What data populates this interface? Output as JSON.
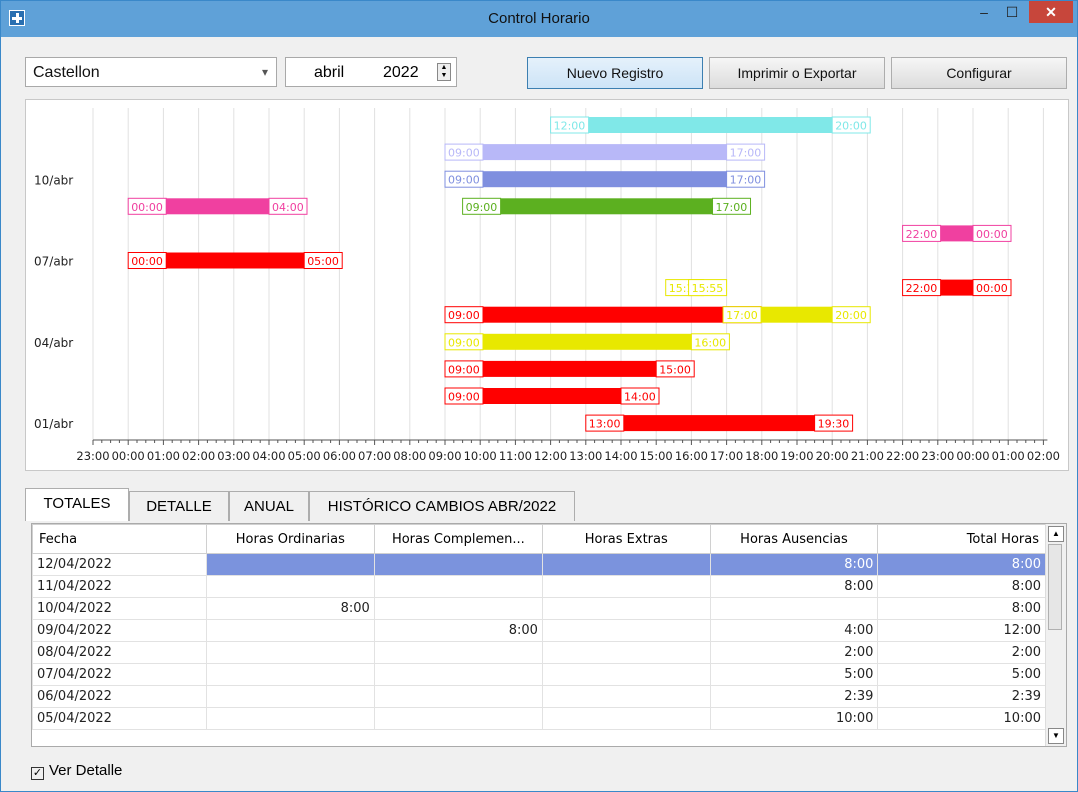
{
  "window": {
    "title": "Control Horario",
    "min_glyph": "–",
    "max_glyph": "☐",
    "close_glyph": "✕"
  },
  "toolbar": {
    "location": "Castellon",
    "month": "abril",
    "year": "2022",
    "new_label": "Nuevo Registro",
    "print_label": "Imprimir o Exportar",
    "config_label": "Configurar"
  },
  "chart_data": {
    "type": "gantt",
    "x_ticks": [
      "23:00",
      "00:00",
      "01:00",
      "02:00",
      "03:00",
      "04:00",
      "05:00",
      "06:00",
      "07:00",
      "08:00",
      "09:00",
      "10:00",
      "11:00",
      "12:00",
      "13:00",
      "14:00",
      "15:00",
      "16:00",
      "17:00",
      "18:00",
      "19:00",
      "20:00",
      "21:00",
      "22:00",
      "23:00",
      "00:00",
      "01:00",
      "02:00"
    ],
    "y_labels": [
      {
        "label": "10/abr",
        "row": 2.3
      },
      {
        "label": "07/abr",
        "row": 5.3
      },
      {
        "label": "04/abr",
        "row": 8.3
      },
      {
        "label": "01/abr",
        "row": 11.3
      }
    ],
    "bars": [
      {
        "row": 0,
        "start": "12:00",
        "end": "20:00",
        "s": 13,
        "e": 21,
        "color": "#80e8e8"
      },
      {
        "row": 1,
        "start": "09:00",
        "end": "17:00",
        "s": 10,
        "e": 18,
        "color": "#b8b8f8"
      },
      {
        "row": 2,
        "start": "09:00",
        "end": "17:00",
        "s": 10,
        "e": 18,
        "color": "#7f8fdf"
      },
      {
        "row": 3,
        "start": "00:00",
        "end": "04:00",
        "s": 1,
        "e": 5,
        "color": "#f040a0"
      },
      {
        "row": 3,
        "start": "09:00",
        "end": "17:00",
        "s": 10.5,
        "e": 17.6,
        "color": "#5cb020"
      },
      {
        "row": 4,
        "start": "22:00",
        "end": "00:00",
        "s": 23,
        "e": 25,
        "color": "#f040a0"
      },
      {
        "row": 5,
        "start": "00:00",
        "end": "05:00",
        "s": 1,
        "e": 6,
        "color": "#ff0000"
      },
      {
        "row": 6,
        "start": "15:16",
        "end": "15:55",
        "s": 16.27,
        "e": 16.92,
        "color": "#e8e800"
      },
      {
        "row": 6,
        "start": "22:00",
        "end": "00:00",
        "s": 23,
        "e": 25,
        "color": "#ff0000"
      },
      {
        "row": 7,
        "start": "09:00",
        "end": "17:00",
        "s": 10,
        "e": 17.9,
        "color": "#ff0000"
      },
      {
        "row": 7,
        "start": "17:00",
        "end": "20:00",
        "s": 17.9,
        "e": 21,
        "color": "#e8e800"
      },
      {
        "row": 8,
        "start": "09:00",
        "end": "16:00",
        "s": 10,
        "e": 17,
        "color": "#e8e800"
      },
      {
        "row": 9,
        "start": "09:00",
        "end": "15:00",
        "s": 10,
        "e": 16,
        "color": "#ff0000"
      },
      {
        "row": 10,
        "start": "09:00",
        "end": "14:00",
        "s": 10,
        "e": 15,
        "color": "#ff0000"
      },
      {
        "row": 11,
        "start": "13:00",
        "end": "19:30",
        "s": 14,
        "e": 20.5,
        "color": "#ff0000"
      }
    ]
  },
  "tabs": [
    {
      "label": "TOTALES"
    },
    {
      "label": "DETALLE"
    },
    {
      "label": "ANUAL"
    },
    {
      "label": "HISTÓRICO CAMBIOS  ABR/2022"
    }
  ],
  "table": {
    "headers": [
      "Fecha",
      "Horas Ordinarias",
      "Horas Complemen...",
      "Horas Extras",
      "Horas Ausencias",
      "Total Horas"
    ],
    "rows": [
      [
        "12/04/2022",
        "",
        "",
        "",
        "8:00",
        "8:00"
      ],
      [
        "11/04/2022",
        "",
        "",
        "",
        "8:00",
        "8:00"
      ],
      [
        "10/04/2022",
        "8:00",
        "",
        "",
        "",
        "8:00"
      ],
      [
        "09/04/2022",
        "",
        "8:00",
        "",
        "4:00",
        "12:00"
      ],
      [
        "08/04/2022",
        "",
        "",
        "",
        "2:00",
        "2:00"
      ],
      [
        "07/04/2022",
        "",
        "",
        "",
        "5:00",
        "5:00"
      ],
      [
        "06/04/2022",
        "",
        "",
        "",
        "2:39",
        "2:39"
      ],
      [
        "05/04/2022",
        "",
        "",
        "",
        "10:00",
        "10:00"
      ]
    ]
  },
  "footer": {
    "ver_detalle": "Ver Detalle"
  }
}
